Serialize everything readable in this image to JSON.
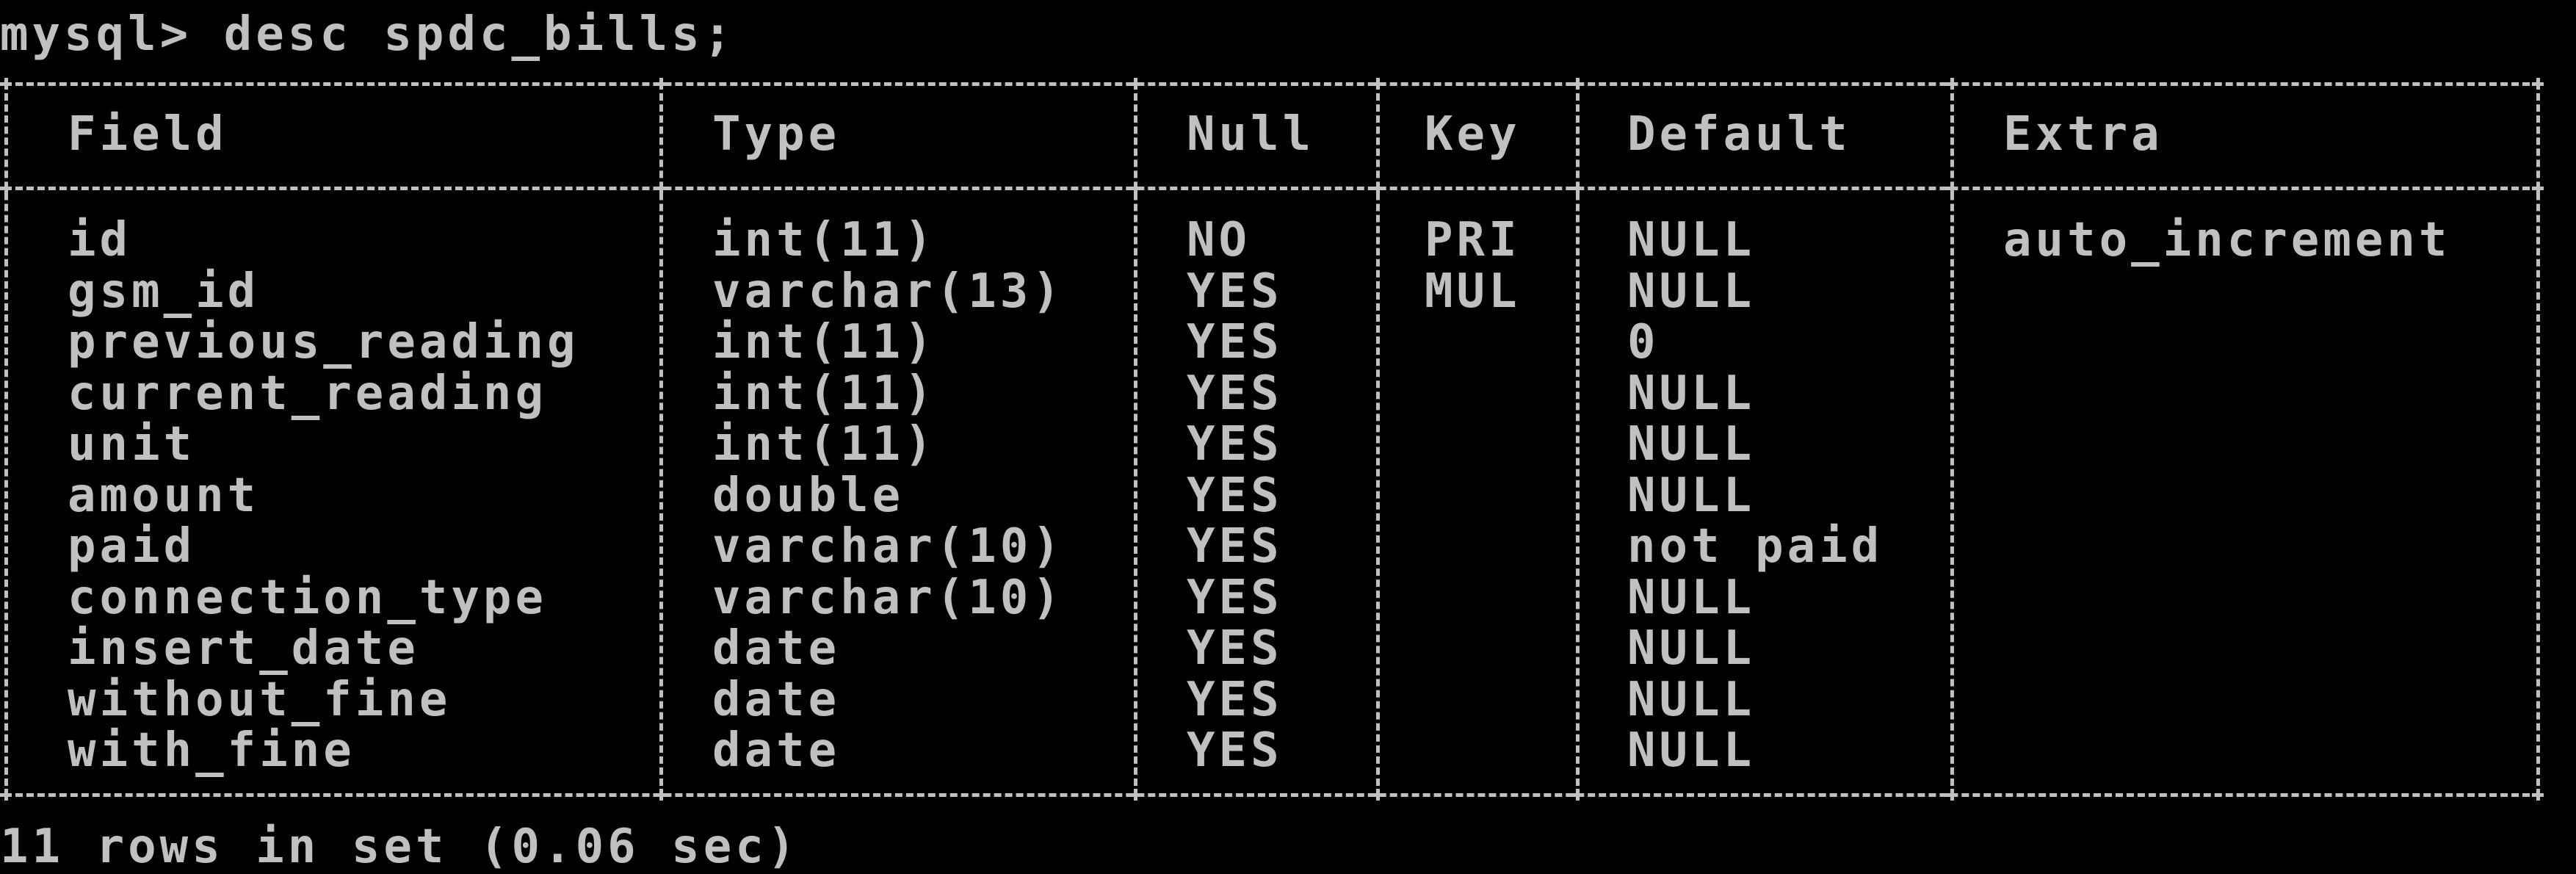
{
  "terminal": {
    "prompt": "mysql> desc spdc_bills;",
    "result": "11 rows in set (0.06 sec)"
  },
  "table": {
    "headers": [
      "Field",
      "Type",
      "Null",
      "Key",
      "Default",
      "Extra"
    ],
    "rows": [
      [
        "id",
        "int(11)",
        "NO",
        "PRI",
        "NULL",
        "auto_increment"
      ],
      [
        "gsm_id",
        "varchar(13)",
        "YES",
        "MUL",
        "NULL",
        ""
      ],
      [
        "previous_reading",
        "int(11)",
        "YES",
        "",
        "0",
        ""
      ],
      [
        "current_reading",
        "int(11)",
        "YES",
        "",
        "NULL",
        ""
      ],
      [
        "unit",
        "int(11)",
        "YES",
        "",
        "NULL",
        ""
      ],
      [
        "amount",
        "double",
        "YES",
        "",
        "NULL",
        ""
      ],
      [
        "paid",
        "varchar(10)",
        "YES",
        "",
        "not paid",
        ""
      ],
      [
        "connection_type",
        "varchar(10)",
        "YES",
        "",
        "NULL",
        ""
      ],
      [
        "insert_date",
        "date",
        "YES",
        "",
        "NULL",
        ""
      ],
      [
        "without_fine",
        "date",
        "YES",
        "",
        "NULL",
        ""
      ],
      [
        "with_fine",
        "date",
        "YES",
        "",
        "NULL",
        ""
      ]
    ]
  },
  "colors": {
    "background": "#000000",
    "text": "#c0c0c0"
  }
}
